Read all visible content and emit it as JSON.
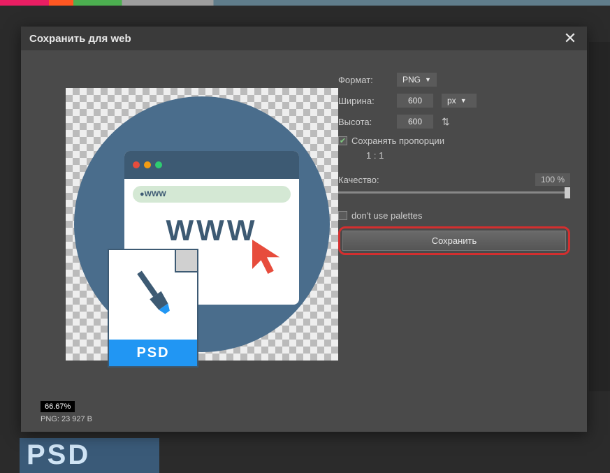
{
  "dialog": {
    "title": "Сохранить для web"
  },
  "controls": {
    "format": {
      "label": "Формат:",
      "value": "PNG"
    },
    "width": {
      "label": "Ширина:",
      "value": "600",
      "unit": "px"
    },
    "height": {
      "label": "Высота:",
      "value": "600"
    },
    "keep_proportions": {
      "label": "Сохранять пропорции",
      "checked": true
    },
    "ratio": "1 : 1",
    "quality": {
      "label": "Качество:",
      "value": "100 %"
    },
    "dont_use_palettes": {
      "label": "don't use palettes",
      "checked": false
    },
    "save_button": "Сохранить"
  },
  "preview": {
    "url_text": "WWW",
    "www_big": "WWW",
    "psd_label": "PSD"
  },
  "status": {
    "zoom": "66.67%",
    "filesize": "PNG: 23 927 B"
  },
  "thumb": {
    "psd_text": "PSD"
  }
}
